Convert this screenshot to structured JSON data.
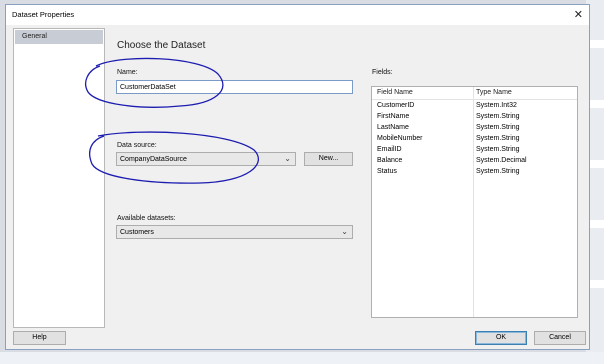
{
  "dialog": {
    "title": "Dataset Properties",
    "close_icon": "close-icon",
    "nav": {
      "items": [
        {
          "label": "General",
          "selected": true
        }
      ]
    },
    "heading": "Choose the Dataset",
    "name": {
      "label": "Name:",
      "value": "CustomerDataSet"
    },
    "datasource": {
      "label": "Data source:",
      "value": "CompanyDataSource",
      "new_label": "New..."
    },
    "available": {
      "label": "Available datasets:",
      "value": "Customers"
    },
    "fields": {
      "label": "Fields:",
      "columns": [
        "Field Name",
        "Type Name"
      ],
      "rows": [
        [
          "CustomerID",
          "System.Int32"
        ],
        [
          "FirstName",
          "System.String"
        ],
        [
          "LastName",
          "System.String"
        ],
        [
          "MobileNumber",
          "System.String"
        ],
        [
          "EmailID",
          "System.String"
        ],
        [
          "Balance",
          "System.Decimal"
        ],
        [
          "Status",
          "System.String"
        ]
      ]
    },
    "footer": {
      "help": "Help",
      "ok": "OK",
      "cancel": "Cancel"
    }
  },
  "colors": {
    "annotation_ink": "#1c1cb0",
    "focus_border": "#7a9ac8",
    "nav_selected": "#c8ccd4"
  }
}
